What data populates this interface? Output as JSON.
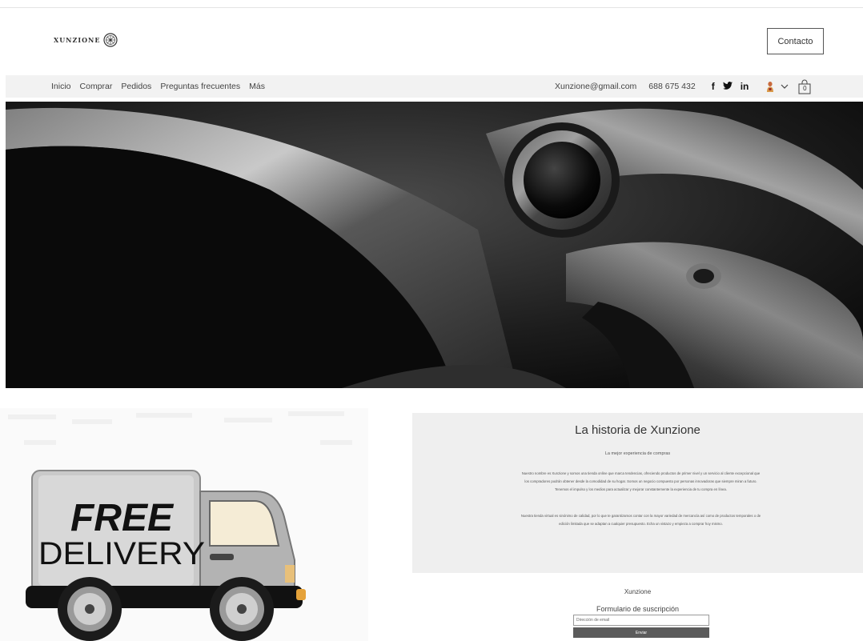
{
  "header": {
    "logo_text": "XUNZIONE",
    "contact_label": "Contacto"
  },
  "nav": {
    "items": [
      {
        "label": "Inicio"
      },
      {
        "label": "Comprar"
      },
      {
        "label": "Pedidos"
      },
      {
        "label": "Preguntas frecuentes"
      },
      {
        "label": "Más"
      }
    ],
    "email": "Xunzione@gmail.com",
    "phone": "688 675 432",
    "social": [
      "f",
      "𝕏",
      "in"
    ],
    "cart_count": "0"
  },
  "delivery": {
    "line1": "FREE",
    "line2": "DELIVERY"
  },
  "story": {
    "title": "La historia de Xunzione",
    "subtitle": "La mejor experiencia de compras",
    "paragraph1": "Nuestro nombre es Xunzione y somos una tienda online que marca tendencias, ofreciendo productos de primer nivel y un servicio al cliente excepcional que los compradores podrán obtener desde la comodidad de su hogar. Somos un negocio compuesto por personas innovadoras que siempre miran a futuro. Tenemos el impulso y los medios para actualizar y mejorar constantemente la experiencia de tu compra en línea.",
    "paragraph2": "Nuestra tienda virtual es sinónimo de calidad, por lo que te garantizamos contar con la mayor variedad de mercancía así como de productos temporales o de edición limitada que se adaptan a cualquier presupuesto. Echa un vistazo y empieza a comprar hoy mismo."
  },
  "footer": {
    "brand": "Xunzione",
    "form_title": "Formulario de suscripción",
    "email_placeholder": "Dirección de email",
    "submit_label": "Enviar"
  },
  "colors": {
    "nav_bg": "#f2f2f2",
    "story_bg": "#efefef",
    "button_bg": "#5b5b5b"
  }
}
